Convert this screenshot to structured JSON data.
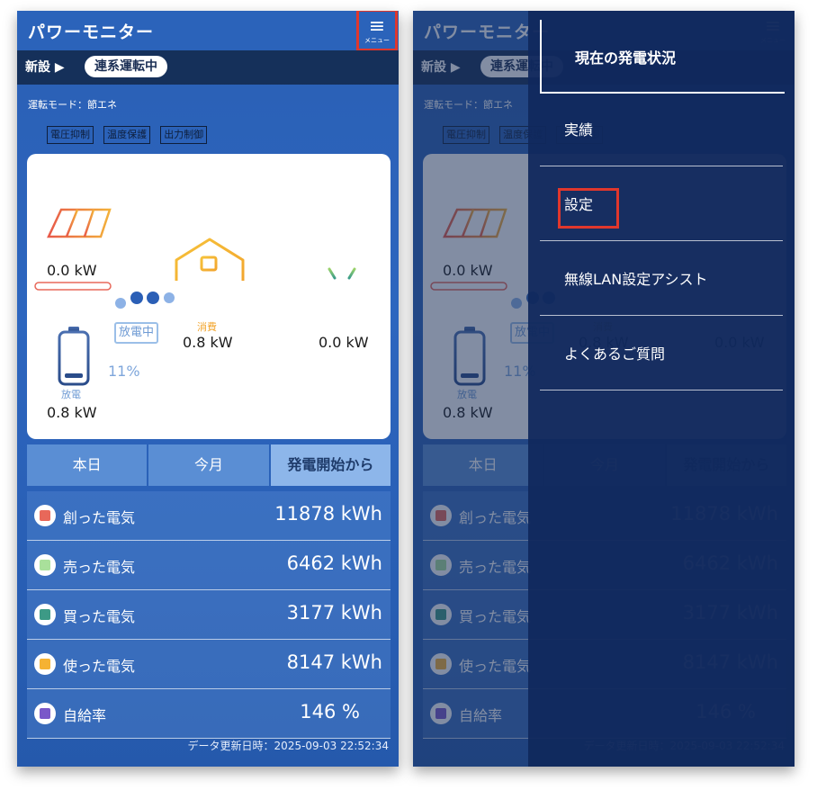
{
  "app": {
    "title": "パワーモニター",
    "menu_label": "メニュー"
  },
  "status": {
    "new_label": "新設 ▶",
    "grid_state": "連系運転中"
  },
  "mode": {
    "text": "運転モード：節エネ",
    "tags": [
      "電圧抑制",
      "温度保護",
      "出力制御"
    ]
  },
  "flow": {
    "solar": {
      "value": "0.0 kW"
    },
    "house": {
      "label": "消費",
      "value": "0.8 kW"
    },
    "battery": {
      "state_badge": "放電中",
      "percent": "11%",
      "label": "放電",
      "value": "0.8 kW"
    },
    "grid": {
      "value": "0.0 kW"
    }
  },
  "tabs": [
    {
      "label": "本日",
      "active": false
    },
    {
      "label": "今月",
      "active": false
    },
    {
      "label": "発電開始から",
      "active": true
    }
  ],
  "stats": [
    {
      "label": "創った電気",
      "value": "11878 kWh",
      "color": "#e8685a"
    },
    {
      "label": "売った電気",
      "value": "6462 kWh",
      "color": "#a9e09b"
    },
    {
      "label": "買った電気",
      "value": "3177 kWh",
      "color": "#3d9a86"
    },
    {
      "label": "使った電気",
      "value": "8147 kWh",
      "color": "#f5b233"
    },
    {
      "label": "自給率",
      "value": "146 %",
      "color": "#7a58c9"
    }
  ],
  "footer": {
    "updated": "データ更新日時：2025-09-03 22:52:34"
  },
  "drawer": {
    "items": [
      "現在の発電状況",
      "実績",
      "設定",
      "無線LAN設定アシスト",
      "よくあるご質問"
    ]
  },
  "colors": {
    "highlight": "#e0372c",
    "primary": "#2b63ba",
    "status_bar": "#15305a"
  }
}
